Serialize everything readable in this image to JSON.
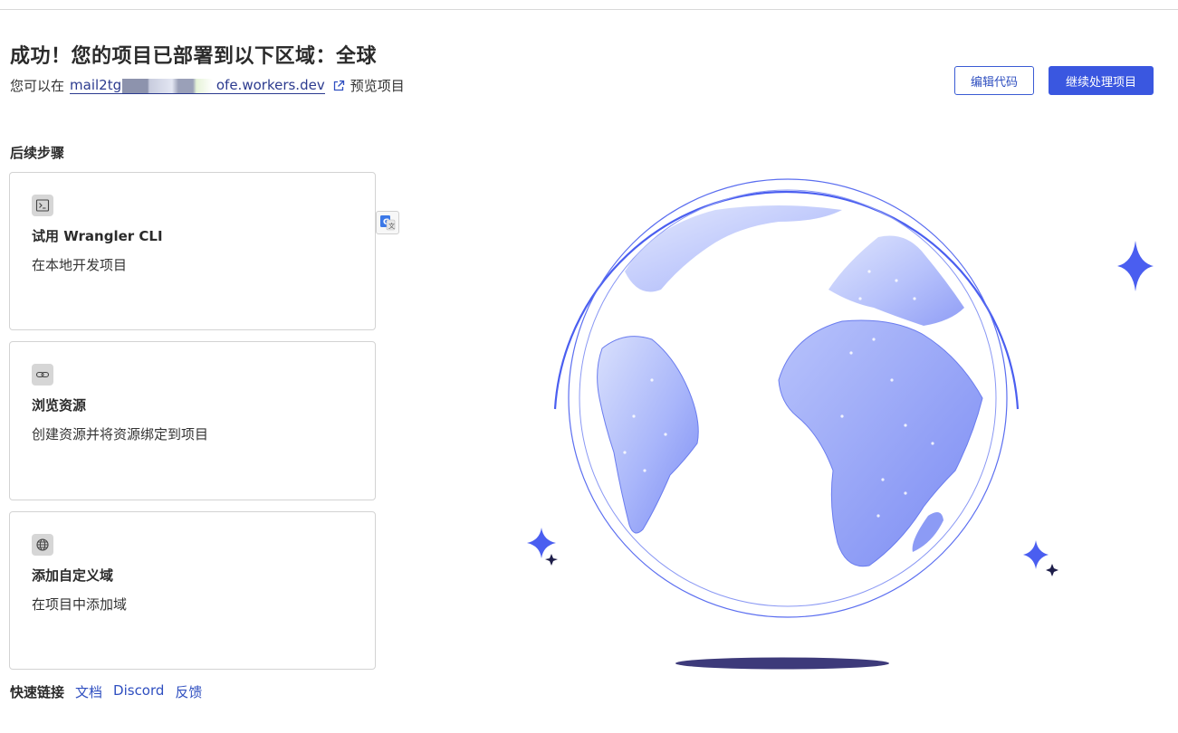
{
  "header": {
    "title": "成功！您的项目已部署到以下区域：全球",
    "preview_prefix": "您可以在",
    "preview_url": "mail2tg.",
    "preview_url_suffix": "ofe.workers.dev",
    "preview_suffix": "预览项目"
  },
  "actions": {
    "edit_code": "编辑代码",
    "continue_project": "继续处理项目"
  },
  "next_steps": {
    "title": "后续步骤",
    "cards": [
      {
        "icon": "terminal-icon",
        "title": "试用 Wrangler CLI",
        "desc": "在本地开发项目"
      },
      {
        "icon": "link-icon",
        "title": "浏览资源",
        "desc": "创建资源并将资源绑定到项目"
      },
      {
        "icon": "globe-icon",
        "title": "添加自定义域",
        "desc": "在项目中添加域"
      }
    ]
  },
  "quick_links": {
    "label": "快速链接",
    "items": [
      "文档",
      "Discord",
      "反馈"
    ]
  },
  "colors": {
    "accent": "#3a57e0",
    "link": "#2f4fc0",
    "globe_light": "#cdd6fb",
    "globe_dark": "#7f8ff5",
    "sparkle": "#4a5ef0",
    "shadow": "#3d3a7a"
  }
}
